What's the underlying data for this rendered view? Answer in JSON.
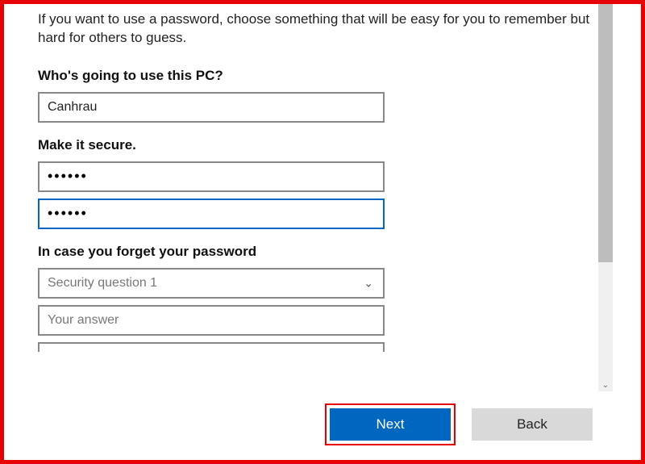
{
  "intro": "If you want to use a password, choose something that will be easy for you to remember but hard for others to guess.",
  "sections": {
    "user_label": "Who's going to use this PC?",
    "username_value": "Canhrau",
    "password_label": "Make it secure.",
    "password_value": "••••••",
    "confirm_password_value": "••••••",
    "recovery_label": "In case you forget your password",
    "security_question_placeholder": "Security question 1",
    "answer_placeholder": "Your answer"
  },
  "buttons": {
    "next": "Next",
    "back": "Back"
  }
}
